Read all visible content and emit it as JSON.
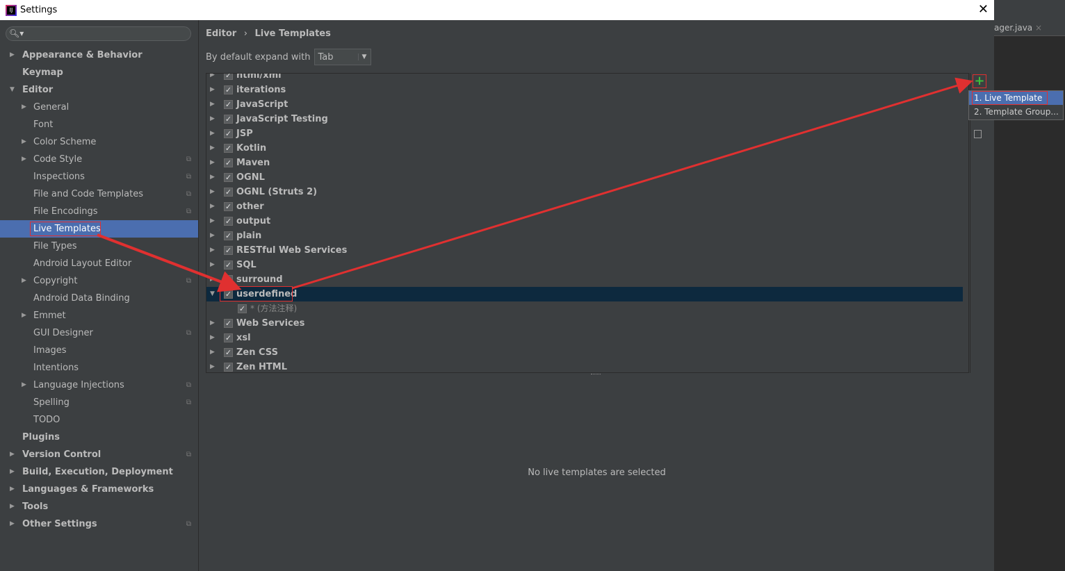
{
  "window": {
    "title": "Settings",
    "close": "✕"
  },
  "editor_tab": {
    "label": "ager.java",
    "close": "×"
  },
  "search": {
    "icon": "search-icon",
    "value": ""
  },
  "sidebar": {
    "items": [
      {
        "label": "Appearance & Behavior",
        "level": 0,
        "arrow": "▶"
      },
      {
        "label": "Keymap",
        "level": 0,
        "arrow": ""
      },
      {
        "label": "Editor",
        "level": 0,
        "arrow": "▼"
      },
      {
        "label": "General",
        "level": 1,
        "arrow": "▶"
      },
      {
        "label": "Font",
        "level": 1,
        "arrow": ""
      },
      {
        "label": "Color Scheme",
        "level": 1,
        "arrow": "▶"
      },
      {
        "label": "Code Style",
        "level": 1,
        "arrow": "▶",
        "copy": true
      },
      {
        "label": "Inspections",
        "level": 1,
        "arrow": "",
        "copy": true
      },
      {
        "label": "File and Code Templates",
        "level": 1,
        "arrow": "",
        "copy": true
      },
      {
        "label": "File Encodings",
        "level": 1,
        "arrow": "",
        "copy": true
      },
      {
        "label": "Live Templates",
        "level": 1,
        "arrow": "",
        "selected": true
      },
      {
        "label": "File Types",
        "level": 1,
        "arrow": ""
      },
      {
        "label": "Android Layout Editor",
        "level": 1,
        "arrow": ""
      },
      {
        "label": "Copyright",
        "level": 1,
        "arrow": "▶",
        "copy": true
      },
      {
        "label": "Android Data Binding",
        "level": 1,
        "arrow": ""
      },
      {
        "label": "Emmet",
        "level": 1,
        "arrow": "▶"
      },
      {
        "label": "GUI Designer",
        "level": 1,
        "arrow": "",
        "copy": true
      },
      {
        "label": "Images",
        "level": 1,
        "arrow": ""
      },
      {
        "label": "Intentions",
        "level": 1,
        "arrow": ""
      },
      {
        "label": "Language Injections",
        "level": 1,
        "arrow": "▶",
        "copy": true
      },
      {
        "label": "Spelling",
        "level": 1,
        "arrow": "",
        "copy": true
      },
      {
        "label": "TODO",
        "level": 1,
        "arrow": ""
      },
      {
        "label": "Plugins",
        "level": 0,
        "arrow": ""
      },
      {
        "label": "Version Control",
        "level": 0,
        "arrow": "▶",
        "copy": true
      },
      {
        "label": "Build, Execution, Deployment",
        "level": 0,
        "arrow": "▶"
      },
      {
        "label": "Languages & Frameworks",
        "level": 0,
        "arrow": "▶"
      },
      {
        "label": "Tools",
        "level": 0,
        "arrow": "▶"
      },
      {
        "label": "Other Settings",
        "level": 0,
        "arrow": "▶",
        "copy": true
      }
    ]
  },
  "breadcrumb": {
    "parent": "Editor",
    "sep": "›",
    "current": "Live Templates"
  },
  "expand": {
    "label": "By default expand with",
    "value": "Tab",
    "arrow": "▼"
  },
  "tree": [
    {
      "label": "html/xml",
      "checked": true,
      "arrow": "▶"
    },
    {
      "label": "iterations",
      "checked": true,
      "arrow": "▶"
    },
    {
      "label": "JavaScript",
      "checked": true,
      "arrow": "▶"
    },
    {
      "label": "JavaScript Testing",
      "checked": true,
      "arrow": "▶"
    },
    {
      "label": "JSP",
      "checked": true,
      "arrow": "▶"
    },
    {
      "label": "Kotlin",
      "checked": true,
      "arrow": "▶"
    },
    {
      "label": "Maven",
      "checked": true,
      "arrow": "▶"
    },
    {
      "label": "OGNL",
      "checked": true,
      "arrow": "▶"
    },
    {
      "label": "OGNL (Struts 2)",
      "checked": true,
      "arrow": "▶"
    },
    {
      "label": "other",
      "checked": true,
      "arrow": "▶"
    },
    {
      "label": "output",
      "checked": true,
      "arrow": "▶"
    },
    {
      "label": "plain",
      "checked": true,
      "arrow": "▶"
    },
    {
      "label": "RESTful Web Services",
      "checked": true,
      "arrow": "▶"
    },
    {
      "label": "SQL",
      "checked": true,
      "arrow": "▶"
    },
    {
      "label": "surround",
      "checked": true,
      "arrow": "▶"
    },
    {
      "label": "userdefined",
      "checked": true,
      "arrow": "▼",
      "selected": true
    },
    {
      "label": "* (方法注释)",
      "checked": true,
      "arrow": "",
      "child": true
    },
    {
      "label": "Web Services",
      "checked": true,
      "arrow": "▶"
    },
    {
      "label": "xsl",
      "checked": true,
      "arrow": "▶"
    },
    {
      "label": "Zen CSS",
      "checked": true,
      "arrow": "▶"
    },
    {
      "label": "Zen HTML",
      "checked": true,
      "arrow": "▶"
    }
  ],
  "toolbar": {
    "add": "+",
    "add_icon": "plus-icon",
    "second_icon": "list-icon"
  },
  "popup": {
    "items": [
      "1. Live Template",
      "2. Template Group..."
    ]
  },
  "empty_message": "No live templates are selected",
  "colors": {
    "accent": "#4b6eaf",
    "annotation": "#e03030",
    "selected_row": "#0d293e",
    "add": "#3bbf3b"
  }
}
